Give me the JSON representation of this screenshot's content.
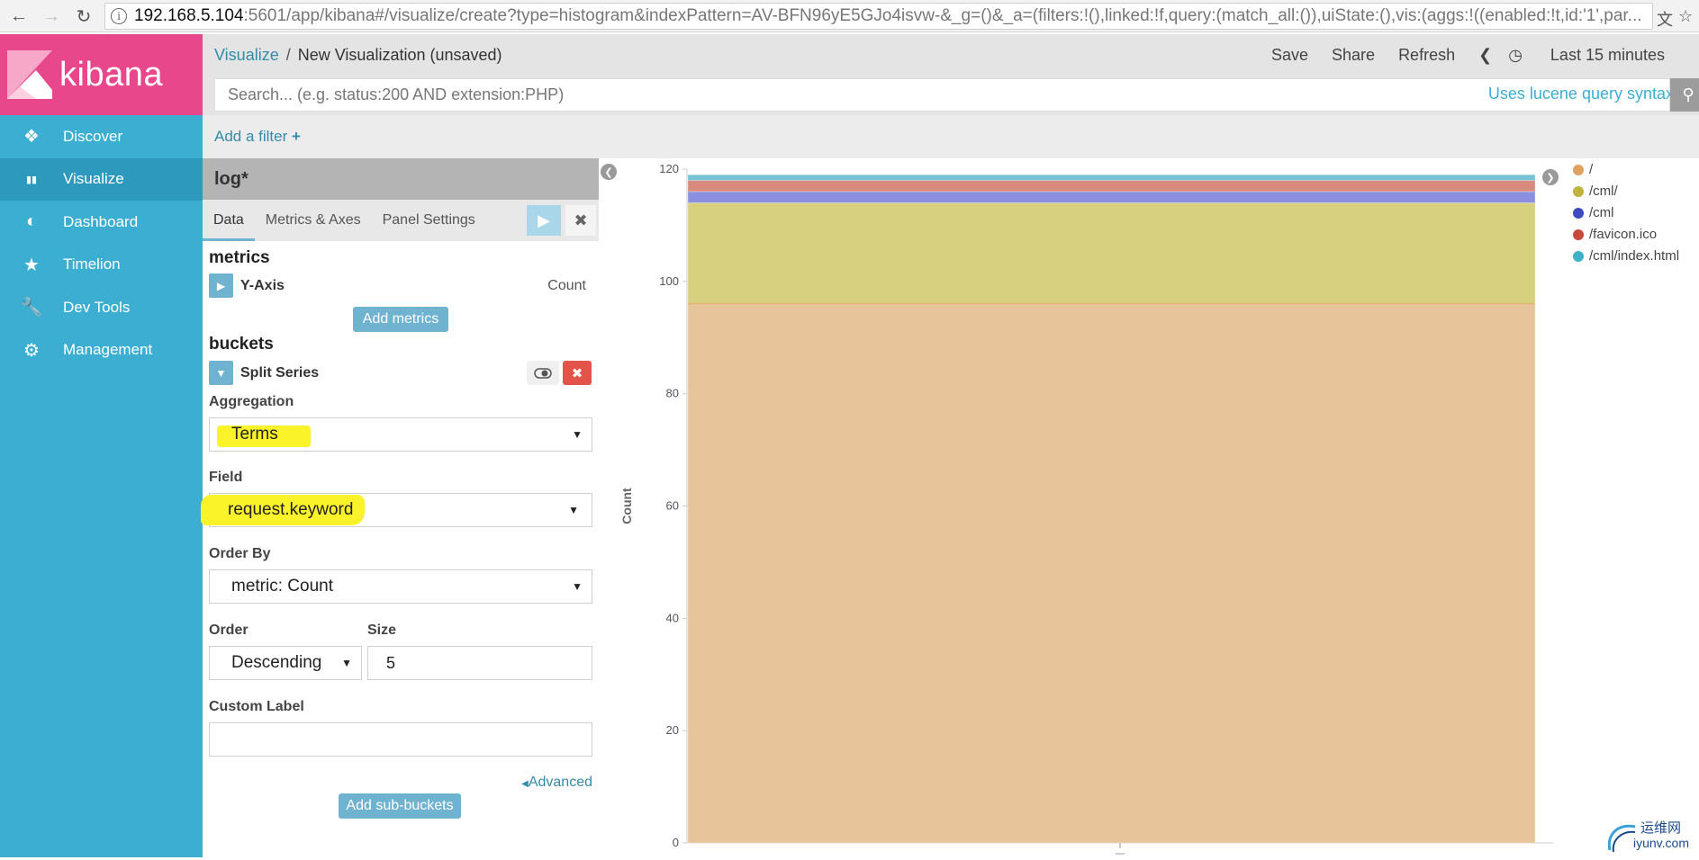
{
  "browser": {
    "url_host": "192.168.5.104",
    "url_rest": ":5601/app/kibana#/visualize/create?type=histogram&indexPattern=AV-BFN96yE5GJo4isvw-&_g=()&_a=(filters:!(),linked:!f,query:(match_all:()),uiState:(),vis:(aggs:!((enabled:!t,id:'1',par..."
  },
  "sidebar": {
    "logo_text": "kibana",
    "items": [
      {
        "label": "Discover",
        "icon": "compass-icon"
      },
      {
        "label": "Visualize",
        "icon": "bar-chart-icon"
      },
      {
        "label": "Dashboard",
        "icon": "dashboard-gauge-icon"
      },
      {
        "label": "Timelion",
        "icon": "timelion-icon"
      },
      {
        "label": "Dev Tools",
        "icon": "wrench-icon"
      },
      {
        "label": "Management",
        "icon": "gear-icon"
      }
    ],
    "active_index": 1
  },
  "topbar": {
    "breadcrumb_link": "Visualize",
    "breadcrumb_sep": "/",
    "breadcrumb_current": "New Visualization (unsaved)",
    "save": "Save",
    "share": "Share",
    "refresh": "Refresh",
    "time_range": "Last 15 minutes"
  },
  "search": {
    "placeholder": "Search... (e.g. status:200 AND extension:PHP)",
    "lucene_hint": "Uses lucene query syntax"
  },
  "filter": {
    "add_filter": "Add a filter"
  },
  "editor": {
    "index_pattern": "log*",
    "tabs": [
      "Data",
      "Metrics & Axes",
      "Panel Settings"
    ],
    "active_tab": 0,
    "metrics_title": "metrics",
    "metric_agg_name": "Y-Axis",
    "metric_agg_value": "Count",
    "add_metrics": "Add metrics",
    "buckets_title": "buckets",
    "bucket_agg_name": "Split Series",
    "aggregation_label": "Aggregation",
    "aggregation_value": "Terms",
    "field_label": "Field",
    "field_value": "request.keyword",
    "order_by_label": "Order By",
    "order_by_value": "metric: Count",
    "order_label": "Order",
    "order_value": "Descending",
    "size_label": "Size",
    "size_value": "5",
    "custom_label_label": "Custom Label",
    "custom_label_value": "",
    "advanced": "Advanced",
    "add_sub_buckets": "Add sub-buckets",
    "highlight_color": "#faf32a"
  },
  "chart_data": {
    "type": "bar",
    "stacked": true,
    "categories": [
      ""
    ],
    "ylabel": "Count",
    "xlabel": "",
    "ylim": [
      0,
      120
    ],
    "yticks": [
      0,
      20,
      40,
      60,
      80,
      100,
      120
    ],
    "series": [
      {
        "name": "/",
        "values": [
          96
        ],
        "color": "#e8c49b"
      },
      {
        "name": "/cml/",
        "values": [
          18
        ],
        "color": "#d6d07f"
      },
      {
        "name": "/cml",
        "values": [
          2
        ],
        "color": "#8a8fe0"
      },
      {
        "name": "/favicon.ico",
        "values": [
          2
        ],
        "color": "#d88a7e"
      },
      {
        "name": "/cml/index.html",
        "values": [
          1
        ],
        "color": "#74c4d4"
      }
    ],
    "legend_position": "right",
    "legend_dot_colors": [
      "#e0a060",
      "#c2b33e",
      "#3b4bc0",
      "#c54a3c",
      "#3fb0c8"
    ]
  },
  "watermark": {
    "cn": "运维网",
    "url": "iyunv.com"
  }
}
